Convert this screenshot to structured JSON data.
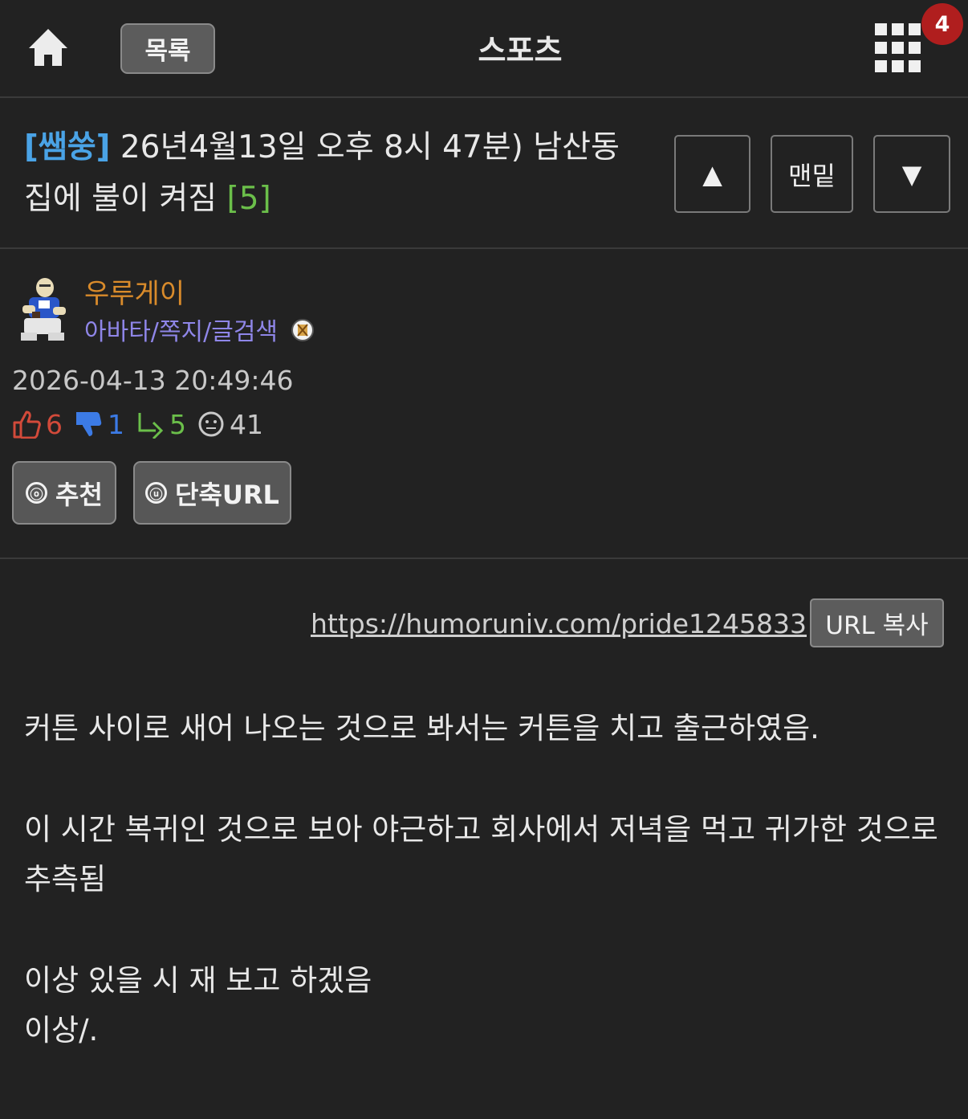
{
  "header": {
    "list_label": "목록",
    "board_title": "스포츠",
    "notification_count": "4"
  },
  "post": {
    "tag": "[쌤쑹]",
    "title": "26년4월13일 오후 8시 47분) 남산동 집에 불이 켜짐",
    "comment_count": "[5]"
  },
  "nav": {
    "up": "▲",
    "bottom": "맨밑",
    "down": "▼"
  },
  "author": {
    "name": "우루게이",
    "links": "아바타/쪽지/글검색"
  },
  "meta": {
    "date": "2026-04-13 20:49:46",
    "upvotes": "6",
    "downvotes": "1",
    "replies": "5",
    "views": "41"
  },
  "actions": {
    "recommend_icon": "ⓞ",
    "recommend": "추천",
    "shorturl_icon": "ⓤ",
    "shorturl": "단축URL"
  },
  "url": {
    "link": "https://humoruniv.com/pride1245833",
    "copy_label": "URL 복사"
  },
  "body": {
    "p1": "커튼 사이로 새어 나오는 것으로 봐서는 커튼을 치고 출근하였음.",
    "p2": "이 시간 복귀인 것으로 보아 야근하고 회사에서 저녁을 먹고 귀가한 것으로 추측됨",
    "p3": "이상 있을 시 재 보고 하겠음",
    "p4": "이상/."
  },
  "colors": {
    "background": "#222222",
    "tag": "#4aa3e6",
    "comment_count": "#6bbf4a",
    "author_name": "#d98b2b",
    "author_links": "#8f86e8",
    "notification": "#b01e1e"
  },
  "icons": {
    "home": "home-icon",
    "menu": "grid-menu-icon",
    "upvote": "thumbs-up-icon",
    "downvote": "thumbs-down-icon",
    "reply": "reply-arrow-icon",
    "views": "face-icon"
  }
}
